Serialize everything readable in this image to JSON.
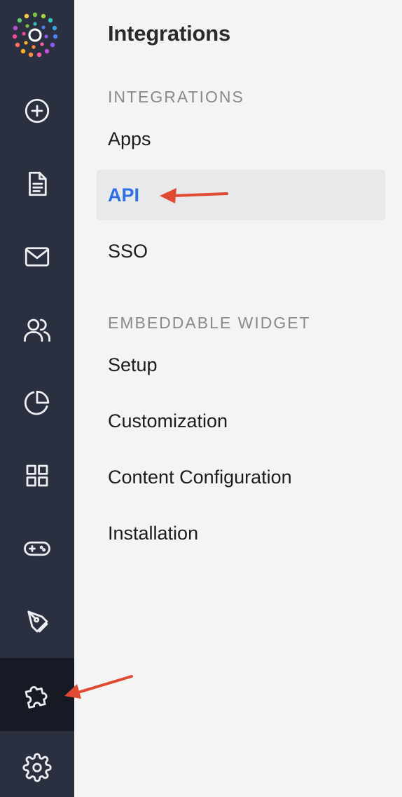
{
  "rail": {
    "logo_icon": "multicolor-dot-burst-logo",
    "items": [
      {
        "icon": "plus-circle-icon"
      },
      {
        "icon": "document-icon"
      },
      {
        "icon": "mail-icon"
      },
      {
        "icon": "users-icon"
      },
      {
        "icon": "pie-chart-icon"
      },
      {
        "icon": "grid-icon"
      },
      {
        "icon": "gamepad-icon"
      },
      {
        "icon": "pen-tool-icon"
      },
      {
        "icon": "puzzle-icon",
        "active": true
      },
      {
        "icon": "gear-icon"
      }
    ]
  },
  "panel": {
    "title": "Integrations",
    "sections": [
      {
        "label": "INTEGRATIONS",
        "items": [
          {
            "label": "Apps"
          },
          {
            "label": "API",
            "active": true
          },
          {
            "label": "SSO"
          }
        ]
      },
      {
        "label": "EMBEDDABLE WIDGET",
        "items": [
          {
            "label": "Setup"
          },
          {
            "label": "Customization"
          },
          {
            "label": "Content Configuration"
          },
          {
            "label": "Installation"
          }
        ]
      }
    ]
  },
  "colors": {
    "rail_bg": "#2b3040",
    "rail_active_bg": "#171a24",
    "panel_bg": "#f4f4f4",
    "active_item_bg": "#e8e9eb",
    "active_item_text": "#2f6fe4",
    "annotation_arrow": "#e04a33"
  }
}
